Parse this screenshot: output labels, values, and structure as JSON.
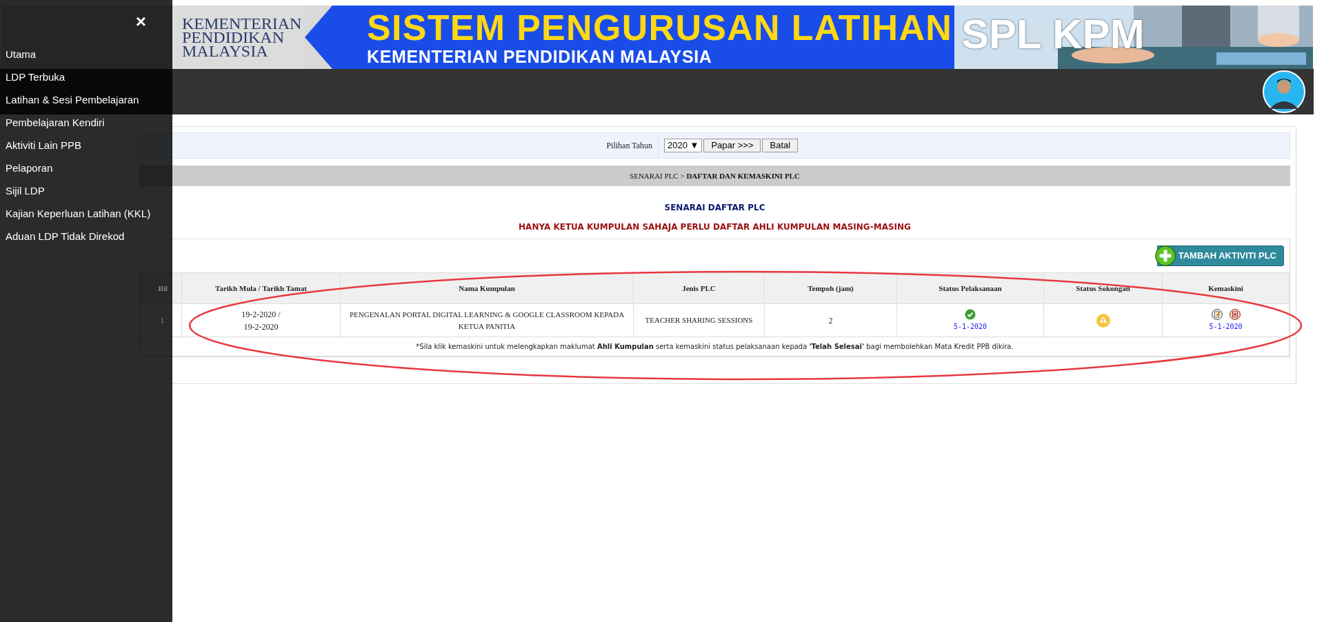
{
  "banner": {
    "ministry_lines": [
      "KEMENTERIAN",
      "PENDIDIKAN",
      "MALAYSIA"
    ],
    "title": "SISTEM PENGURUSAN LATIHAN",
    "subtitle": "KEMENTERIAN PENDIDIKAN MALAYSIA",
    "brand": "SPL KPM"
  },
  "sidebar": {
    "close": "×",
    "items": [
      {
        "label": "Utama"
      },
      {
        "label": "LDP Terbuka"
      },
      {
        "label": "Latihan & Sesi Pembelajaran"
      },
      {
        "label": "Pembelajaran Kendiri"
      },
      {
        "label": "Aktiviti Lain PPB"
      },
      {
        "label": "Pelaporan"
      },
      {
        "label": "Sijil LDP"
      },
      {
        "label": "Kajian Keperluan Latihan (KKL)"
      },
      {
        "label": "Aduan LDP Tidak Direkod"
      }
    ]
  },
  "filter": {
    "label": "Pilihan Tahun",
    "year": "2020 ▼",
    "buttons": [
      "Papar >>>",
      "Batal"
    ]
  },
  "breadcrumb": "SENARAI PLC > **DAFTAR DAN KEMASKINI PLC**",
  "heading": "SENARAI DAFTAR PLC",
  "notice": "HANYA KETUA KUMPULAN SAHAJA PERLU DAFTAR AHLI KUMPULAN MASING-MASING",
  "add_button": "TAMBAH AKTIVITI PLC",
  "table": {
    "columns": [
      "Bil",
      "Tarikh Mula / Tarikh Tamat",
      "Nama Kumpulan",
      "Jenis PLC",
      "Tempoh (jam)",
      "Status Pelaksanaan",
      "Status Sokongan",
      "Kemaskini"
    ],
    "rows": [
      {
        "bil": "1",
        "dates": [
          "19-2-2020 /",
          "19-2-2020"
        ],
        "name": "PENGENALAN PORTAL DIGITAL LEARNING & GOOGLE CLASSROOM KEPADA KETUA PANITIA",
        "type": "TEACHER SHARING SESSIONS",
        "hours": "2",
        "completed": true,
        "status_date": "5-1-2020",
        "support_approved": false,
        "edit_date": "5-1-2020"
      }
    ],
    "note": "*Sila klik kemaskini untuk melengkapkan maklumat **Ahli Kumpulan** serta kemaskini status pelaksanaan kepada **'Telah Selesai'** bagi membolehkan Mata Kredit PPB dikira."
  }
}
